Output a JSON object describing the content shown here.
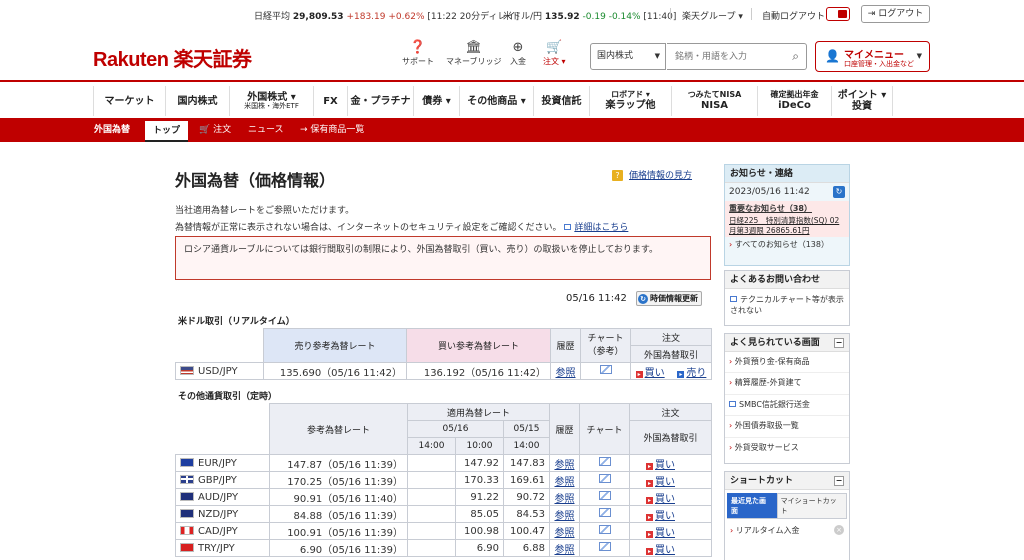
{
  "ticker": {
    "nikkei_label": "日経平均",
    "nikkei_value": "29,809.53",
    "nikkei_change": "+183.19",
    "nikkei_pct": "+0.62%",
    "nikkei_time": "[11:22 20分ディレイ]",
    "usdjpy_label": "米ドル/円",
    "usdjpy_value": "135.92",
    "usdjpy_change": "-0.19",
    "usdjpy_pct": "-0.14%",
    "usdjpy_time": "[11:40]",
    "group_label": "楽天グループ",
    "auto_logout_label": "自動ログアウト",
    "logout_label": "ログアウト"
  },
  "header": {
    "logo_text": "Rakuten 楽天証券",
    "icons": [
      {
        "label": "サポート",
        "icon": "support-icon"
      },
      {
        "label": "マネーブリッジ",
        "icon": "bank-icon"
      },
      {
        "label": "入金",
        "icon": "deposit-icon"
      },
      {
        "label": "注文",
        "icon": "cart-icon"
      }
    ],
    "market_select": "国内株式",
    "search_placeholder": "銘柄・用語を入力",
    "mymenu_title": "マイメニュー",
    "mymenu_sub": "口座管理・入出金など"
  },
  "global_nav": [
    {
      "label": "マーケット",
      "sub": ""
    },
    {
      "label": "国内株式",
      "sub": ""
    },
    {
      "label": "外国株式",
      "sub": "米国株・海外ETF"
    },
    {
      "label": "FX",
      "sub": ""
    },
    {
      "label": "金・プラチナ",
      "sub": ""
    },
    {
      "label": "債券",
      "sub": ""
    },
    {
      "label": "その他商品",
      "sub": ""
    },
    {
      "label": "投資信託",
      "sub": ""
    },
    {
      "label": "ロボアド",
      "sub": "楽ラップ他"
    },
    {
      "label": "つみたてNISA",
      "sub": "NISA"
    },
    {
      "label": "確定拠出年金",
      "sub": "iDeCo"
    },
    {
      "label": "ポイント",
      "sub": "投資"
    }
  ],
  "sub_nav": {
    "category": "外国為替",
    "items": [
      "トップ",
      "注文",
      "ニュース",
      "保有商品一覧"
    ]
  },
  "page": {
    "title": "外国為替（価格情報）",
    "help_link": "価格情報の見方",
    "intro1": "当社適用為替レートをご参照いただけます。",
    "intro2": "為替情報が正常に表示されない場合は、インターネットのセキュリティ設定をご確認ください。",
    "intro_link": "詳細はこちら",
    "warning": "ロシア通貨ルーブルについては銀行間取引の制限により、外国為替取引（買い、売り）の取扱いを停止しております。",
    "timestamp": "05/16 11:42",
    "refresh_label": "時価情報更新"
  },
  "usd_table": {
    "section_title": "米ドル取引（リアルタイム）",
    "headers": {
      "sell": "売り参考為替レート",
      "buy": "買い参考為替レート",
      "history": "履歴",
      "chart": "チャート（参考）",
      "order": "注文",
      "fx_trade": "外国為替取引"
    },
    "row": {
      "currency": "USD/JPY",
      "sell": "135.690（05/16 11:42）",
      "buy": "136.192（05/16 11:42）",
      "history": "参照",
      "buy_label": "買い",
      "sell_label": "売り"
    }
  },
  "other_table": {
    "section_title": "その他通貨取引（定時）",
    "headers": {
      "ref_rate": "参考為替レート",
      "applied_rate": "適用為替レート",
      "date1": "05/16",
      "date2": "05/15",
      "t1": "14:00",
      "t2": "10:00",
      "t3": "14:00",
      "history": "履歴",
      "chart": "チャート",
      "order": "注文",
      "fx_trade": "外国為替取引"
    },
    "rows": [
      {
        "currency": "EUR/JPY",
        "flag": "eu",
        "ref": "147.87（05/16 11:39）",
        "d1_1400": "",
        "d1_1000": "147.92",
        "d2_1400": "147.83",
        "history": "参照",
        "buy": "買い"
      },
      {
        "currency": "GBP/JPY",
        "flag": "gb",
        "ref": "170.25（05/16 11:39）",
        "d1_1400": "",
        "d1_1000": "170.33",
        "d2_1400": "169.61",
        "history": "参照",
        "buy": "買い"
      },
      {
        "currency": "AUD/JPY",
        "flag": "au",
        "ref": "90.91（05/16 11:40）",
        "d1_1400": "",
        "d1_1000": "91.22",
        "d2_1400": "90.72",
        "history": "参照",
        "buy": "買い"
      },
      {
        "currency": "NZD/JPY",
        "flag": "nz",
        "ref": "84.88（05/16 11:39）",
        "d1_1400": "",
        "d1_1000": "85.05",
        "d2_1400": "84.53",
        "history": "参照",
        "buy": "買い"
      },
      {
        "currency": "CAD/JPY",
        "flag": "ca",
        "ref": "100.91（05/16 11:39）",
        "d1_1400": "",
        "d1_1000": "100.98",
        "d2_1400": "100.47",
        "history": "参照",
        "buy": "買い"
      },
      {
        "currency": "TRY/JPY",
        "flag": "tr",
        "ref": "6.90（05/16 11:39）",
        "d1_1400": "",
        "d1_1000": "6.90",
        "d2_1400": "6.88",
        "history": "参照",
        "buy": "買い"
      }
    ]
  },
  "sidebar": {
    "notice_title": "お知らせ・連絡",
    "notice_time": "2023/05/16 11:42",
    "important_notice": "重要なお知らせ（38）",
    "notice_item": "日経225　特別清算指数(SQ) 02月第3週限 26865.61円",
    "all_notices": "すべてのお知らせ（138）",
    "faq_title": "よくあるお問い合わせ",
    "faq_item": "テクニカルチャート等が表示されない",
    "popular_title": "よく見られている画面",
    "popular_items": [
      "外貨預り金-保有商品",
      "精算履歴-外貨建て",
      "SMBC信託銀行送金",
      "外国債券取扱一覧",
      "外貨受取サービス"
    ],
    "shortcut_title": "ショートカット",
    "shortcut_tabs": [
      "最近見た画面",
      "マイショートカット"
    ],
    "shortcut_item": "リアルタイム入金"
  }
}
